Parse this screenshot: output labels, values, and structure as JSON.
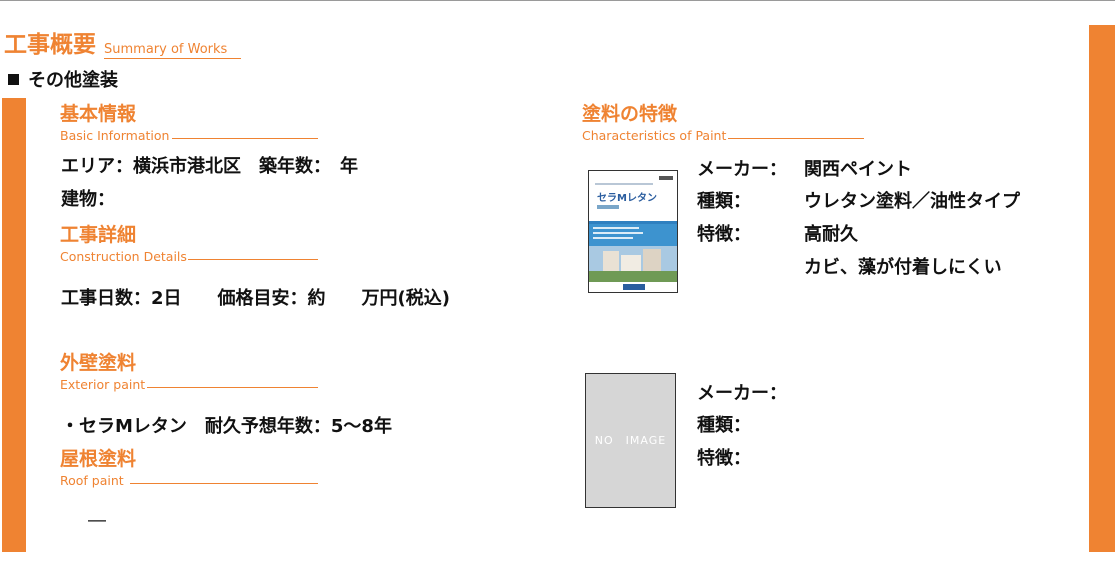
{
  "header": {
    "title": "工事概要",
    "subtitle": "Summary of Works",
    "section": "その他塗装"
  },
  "basic_info": {
    "heading": "基本情報",
    "subheading": "Basic Information",
    "line1": "エリア：横浜市港北区　築年数：　年",
    "line2": "建物："
  },
  "construction": {
    "heading": "工事詳細",
    "subheading": "Construction Details",
    "line1": "工事日数：2日　　価格目安：約　　万円(税込)"
  },
  "exterior": {
    "heading": "外壁塗料",
    "subheading": "Exterior paint",
    "line1": "・セラMレタン　耐久予想年数：5〜8年"
  },
  "roof": {
    "heading": "屋根塗料",
    "subheading": "Roof paint",
    "line1": "―"
  },
  "paint": {
    "heading": "塗料の特徴",
    "subheading": "Characteristics of Paint",
    "product1": {
      "cover_title": "セラMレタン",
      "maker_label": "メーカー：",
      "maker": "関西ペイント",
      "type_label": "種類：",
      "type": "ウレタン塗料／油性タイプ",
      "feature_label": "特徴：",
      "feature1": "高耐久",
      "feature2": "カビ、藻が付着しにくい"
    },
    "product2": {
      "image_placeholder": "NO　IMAGE",
      "maker_label": "メーカー：",
      "type_label": "種類：",
      "feature_label": "特徴："
    }
  },
  "colors": {
    "accent": "#ef8332",
    "text": "#111111",
    "placeholder": "#d6d6d6"
  }
}
